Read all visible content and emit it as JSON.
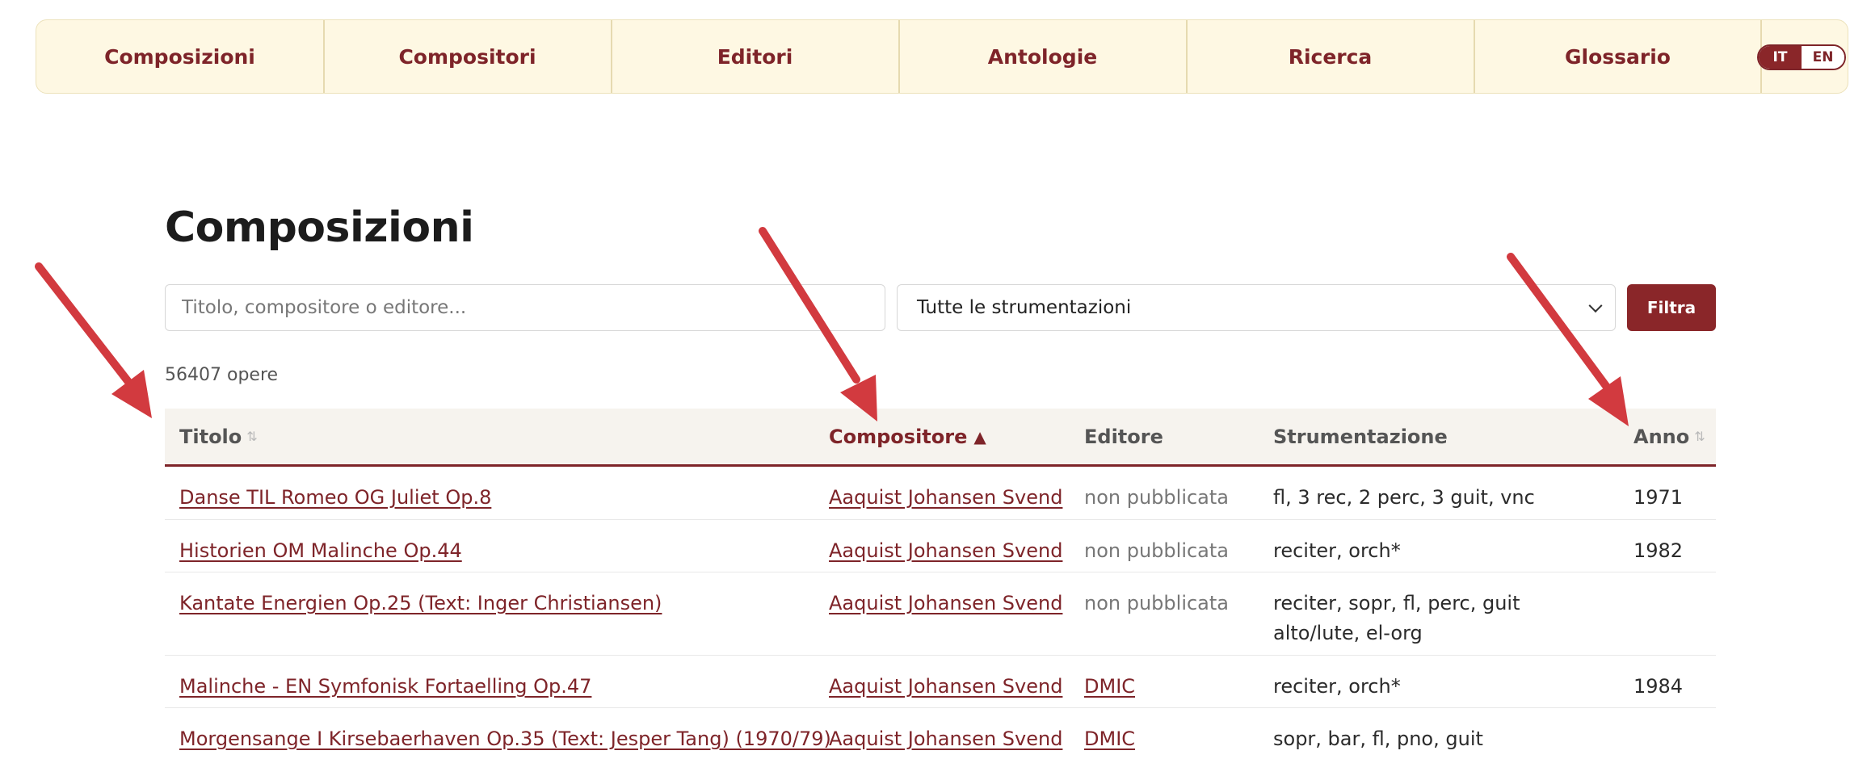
{
  "nav": {
    "items": [
      {
        "label": "Composizioni"
      },
      {
        "label": "Compositori"
      },
      {
        "label": "Editori"
      },
      {
        "label": "Antologie"
      },
      {
        "label": "Ricerca"
      },
      {
        "label": "Glossario"
      }
    ],
    "lang": {
      "active": "IT",
      "other": "EN"
    }
  },
  "page": {
    "title": "Composizioni"
  },
  "filters": {
    "search_placeholder": "Titolo, compositore o editore...",
    "search_value": "",
    "instrumentation_selected": "Tutte le strumentazioni",
    "filter_label": "Filtra"
  },
  "results": {
    "count_text": "56407 opere"
  },
  "table": {
    "headers": {
      "title": "Titolo",
      "composer": "Compositore",
      "publisher": "Editore",
      "instrumentation": "Strumentazione",
      "year": "Anno"
    },
    "sort_both_glyph": "⇅",
    "sort_asc_glyph": "▲",
    "rows": [
      {
        "title": "Danse TIL Romeo OG Juliet Op.8",
        "composer": "Aaquist Johansen Svend",
        "publisher": "non pubblicata",
        "publisher_link": false,
        "instrumentation": "fl, 3 rec, 2 perc, 3 guit, vnc",
        "year": "1971"
      },
      {
        "title": "Historien OM Malinche Op.44",
        "composer": "Aaquist Johansen Svend",
        "publisher": "non pubblicata",
        "publisher_link": false,
        "instrumentation": "reciter, orch*",
        "year": "1982"
      },
      {
        "title": "Kantate Energien Op.25 (Text: Inger Christiansen)",
        "composer": "Aaquist Johansen Svend",
        "publisher": "non pubblicata",
        "publisher_link": false,
        "instrumentation": "reciter, sopr, fl, perc, guit alto/lute, el-org",
        "year": ""
      },
      {
        "title": "Malinche - EN Symfonisk Fortaelling Op.47",
        "composer": "Aaquist Johansen Svend",
        "publisher": "DMIC",
        "publisher_link": true,
        "instrumentation": "reciter, orch*",
        "year": "1984"
      },
      {
        "title": "Morgensange I Kirsebaerhaven Op.35 (Text: Jesper Tang) (1970/79)",
        "composer": "Aaquist Johansen Svend",
        "publisher": "DMIC",
        "publisher_link": true,
        "instrumentation": "sopr, bar, fl, pno, guit",
        "year": ""
      }
    ]
  },
  "colors": {
    "brand": "#8a2629",
    "nav_bg": "#fef8e3",
    "annotation_arrow": "#d23a3f"
  }
}
